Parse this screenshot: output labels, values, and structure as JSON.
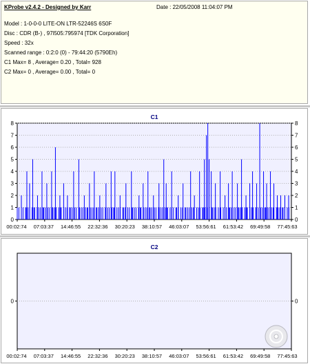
{
  "info": {
    "title": "KProbe v2.4.2 - Designed by Karr",
    "date": "Date : 22/05/2008 11:04:07 PM",
    "model": "Model : 1-0-0-0 LITE-ON LTR-52246S      6S0F",
    "disc": "Disc : CDR (B-) , 97l505:795974 [TDK Corporation]",
    "speed": "Speed : 32x",
    "scanned_range": "Scanned range : 0:2:0 (0) - 79:44:20 (5790Eh)",
    "c1_stats": "C1 Max= 8 , Average= 0.20 , Total= 928",
    "c2_stats": "C2 Max= 0 , Average= 0.00 , Total= 0"
  },
  "colors": {
    "plot_bg": "#f0f0ff",
    "series": "#0000ff",
    "title": "#000080",
    "info_bg": "#fffff0"
  },
  "icons": {
    "disc_watermark": "cd-disc-icon"
  },
  "chart_data": [
    {
      "type": "bar",
      "title": "C1",
      "ylim": [
        0,
        8
      ],
      "yticks": [
        0,
        1,
        2,
        3,
        4,
        5,
        6,
        7,
        8
      ],
      "xticklabels": [
        "00:02:74",
        "07:03:37",
        "14:46:55",
        "22:32:36",
        "30:20:23",
        "38:10:57",
        "46:03:07",
        "53:56:61",
        "61:53:42",
        "69:49:58",
        "77:45:63"
      ],
      "x_range_minutes": [
        0,
        79.7
      ],
      "grid": "horizontal dotted",
      "baseline_pattern": [
        1,
        0,
        1,
        0,
        0,
        1,
        0,
        1,
        0,
        0,
        1,
        1,
        0,
        1,
        0,
        1,
        0,
        0,
        1,
        0,
        1,
        1,
        0,
        0,
        1,
        0,
        1,
        0,
        1,
        0,
        0,
        1
      ],
      "spikes": [
        {
          "x": 1.2,
          "y": 2
        },
        {
          "x": 2.8,
          "y": 4
        },
        {
          "x": 3.6,
          "y": 3
        },
        {
          "x": 4.5,
          "y": 5
        },
        {
          "x": 5.9,
          "y": 2
        },
        {
          "x": 7.2,
          "y": 4
        },
        {
          "x": 8.6,
          "y": 3
        },
        {
          "x": 10.0,
          "y": 4
        },
        {
          "x": 11.1,
          "y": 6
        },
        {
          "x": 12.4,
          "y": 2
        },
        {
          "x": 13.5,
          "y": 3
        },
        {
          "x": 14.6,
          "y": 2
        },
        {
          "x": 16.4,
          "y": 4
        },
        {
          "x": 17.9,
          "y": 5
        },
        {
          "x": 19.5,
          "y": 2
        },
        {
          "x": 21.0,
          "y": 3
        },
        {
          "x": 22.4,
          "y": 4
        },
        {
          "x": 24.0,
          "y": 2
        },
        {
          "x": 25.8,
          "y": 3
        },
        {
          "x": 27.3,
          "y": 4
        },
        {
          "x": 28.4,
          "y": 4
        },
        {
          "x": 29.9,
          "y": 2
        },
        {
          "x": 31.6,
          "y": 3
        },
        {
          "x": 33.2,
          "y": 4
        },
        {
          "x": 35.4,
          "y": 2
        },
        {
          "x": 36.6,
          "y": 3
        },
        {
          "x": 38.0,
          "y": 4
        },
        {
          "x": 39.6,
          "y": 2
        },
        {
          "x": 41.2,
          "y": 3
        },
        {
          "x": 42.6,
          "y": 5
        },
        {
          "x": 43.3,
          "y": 3
        },
        {
          "x": 44.9,
          "y": 4
        },
        {
          "x": 46.8,
          "y": 2
        },
        {
          "x": 48.2,
          "y": 3
        },
        {
          "x": 50.4,
          "y": 4
        },
        {
          "x": 51.5,
          "y": 2
        },
        {
          "x": 53.0,
          "y": 4
        },
        {
          "x": 54.4,
          "y": 5
        },
        {
          "x": 55.0,
          "y": 7
        },
        {
          "x": 55.4,
          "y": 8
        },
        {
          "x": 55.8,
          "y": 5
        },
        {
          "x": 56.4,
          "y": 4
        },
        {
          "x": 57.6,
          "y": 3
        },
        {
          "x": 59.0,
          "y": 4
        },
        {
          "x": 60.4,
          "y": 2
        },
        {
          "x": 61.4,
          "y": 3
        },
        {
          "x": 62.5,
          "y": 4
        },
        {
          "x": 64.0,
          "y": 3
        },
        {
          "x": 65.2,
          "y": 5
        },
        {
          "x": 66.5,
          "y": 2
        },
        {
          "x": 67.6,
          "y": 3
        },
        {
          "x": 68.4,
          "y": 4
        },
        {
          "x": 69.6,
          "y": 3
        },
        {
          "x": 70.5,
          "y": 8
        },
        {
          "x": 71.6,
          "y": 4
        },
        {
          "x": 72.5,
          "y": 3
        },
        {
          "x": 73.6,
          "y": 4
        },
        {
          "x": 74.6,
          "y": 3
        },
        {
          "x": 75.6,
          "y": 2
        },
        {
          "x": 76.6,
          "y": 2
        },
        {
          "x": 77.8,
          "y": 2
        },
        {
          "x": 78.9,
          "y": 2
        }
      ]
    },
    {
      "type": "bar",
      "title": "C2",
      "ylim": [
        -1,
        1
      ],
      "yticks": [
        0
      ],
      "xticklabels": [
        "00:02:74",
        "07:03:37",
        "14:46:55",
        "22:32:36",
        "30:20:23",
        "38:10:57",
        "46:03:07",
        "53:56:61",
        "61:53:42",
        "69:49:58",
        "77:45:63"
      ],
      "values": [],
      "max": 0
    }
  ]
}
